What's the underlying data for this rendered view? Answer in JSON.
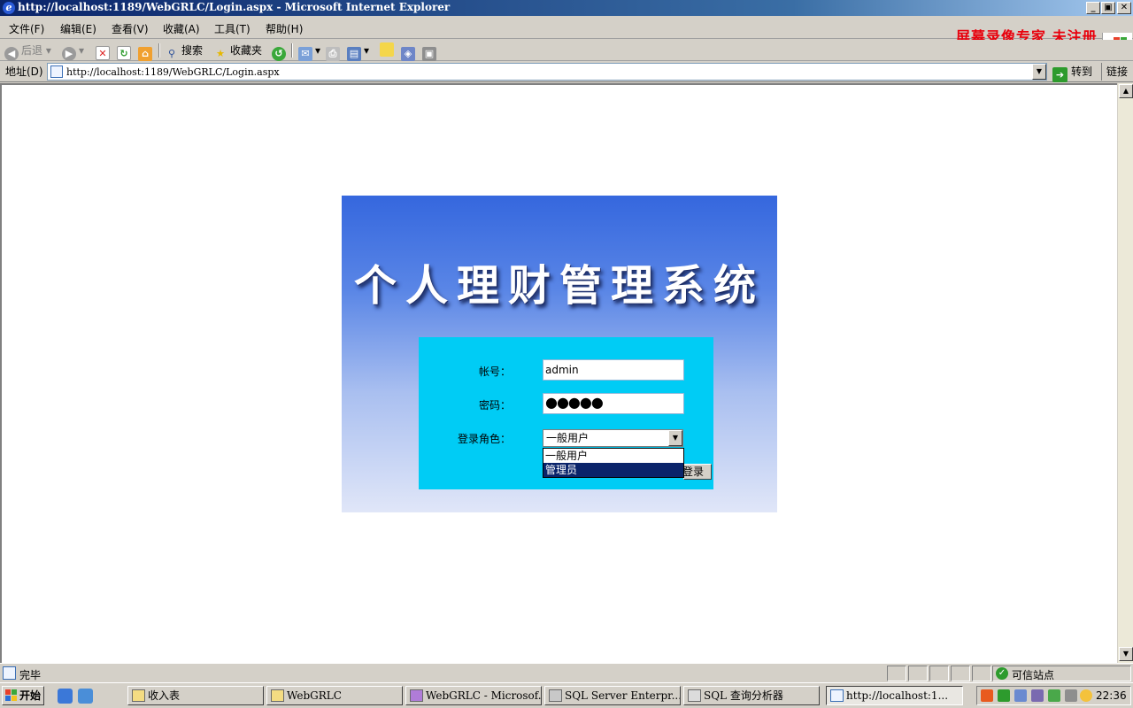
{
  "window": {
    "title": "http://localhost:1189/WebGRLC/Login.aspx - Microsoft Internet Explorer",
    "minimize": "_",
    "maximize": "▣",
    "close": "✕"
  },
  "menu": {
    "items": [
      "文件(F)",
      "编辑(E)",
      "查看(V)",
      "收藏(A)",
      "工具(T)",
      "帮助(H)"
    ]
  },
  "watermark": "屏幕录像专家 未注册",
  "toolbar": {
    "back": "后退",
    "search": "搜索",
    "favorites": "收藏夹"
  },
  "address": {
    "label": "地址(D)",
    "url": "http://localhost:1189/WebGRLC/Login.aspx",
    "go": "转到",
    "links": "链接"
  },
  "page": {
    "system_title": "个人理财管理系统",
    "account_label": "帐号：",
    "account_value": "admin",
    "password_label": "密码：",
    "password_value": "●●●●●",
    "role_label": "登录角色：",
    "role_selected": "一般用户",
    "role_options": [
      "一般用户",
      "管理员"
    ],
    "highlighted_option": "管理员",
    "login_button": "登录"
  },
  "statusbar": {
    "text": "完毕",
    "zone": "可信站点"
  },
  "taskbar": {
    "start": "开始",
    "tasks": [
      {
        "label": "收入表",
        "active": false
      },
      {
        "label": "WebGRLC",
        "active": false
      },
      {
        "label": "WebGRLC - Microsof...",
        "active": false
      },
      {
        "label": "SQL Server Enterpr...",
        "active": false
      },
      {
        "label": "SQL 查询分析器",
        "active": false
      },
      {
        "label": "http://localhost:1...",
        "active": true
      }
    ],
    "clock": "22:36"
  },
  "colors": {
    "panel_top": "#3567de",
    "panel_bottom": "#e0e6f8",
    "form_bg": "#00ccf5",
    "selection": "#0a246a",
    "watermark": "#e8000c"
  }
}
